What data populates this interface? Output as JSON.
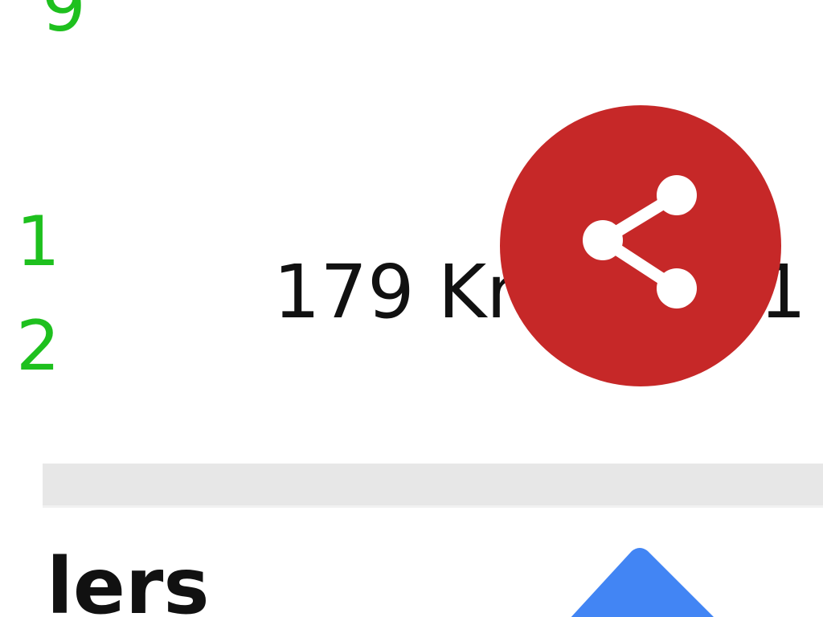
{
  "left_column": {
    "numbers": [
      "9",
      "1",
      "2"
    ]
  },
  "row": {
    "distance_text": "179 Km",
    "distance_suffix": "1"
  },
  "share_button": {
    "icon": "share-icon",
    "color": "#c62828"
  },
  "section": {
    "title_partial": "lers"
  },
  "nav_marker": {
    "icon": "navigation-arrow-icon",
    "color": "#4285f4"
  },
  "colors": {
    "accent_green": "#1ec01e",
    "divider": "#e7e7e7"
  }
}
